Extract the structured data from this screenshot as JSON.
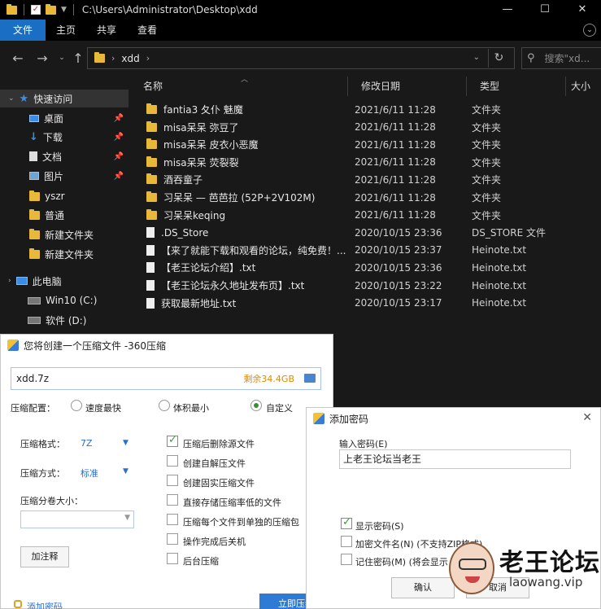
{
  "titlebar": {
    "path": "C:\\Users\\Administrator\\Desktop\\xdd"
  },
  "ribbon": {
    "tabs": [
      "文件",
      "主页",
      "共享",
      "查看"
    ]
  },
  "nav": {
    "crumb": "xdd",
    "search_placeholder": "搜索\"xd..."
  },
  "sidebar": {
    "items": [
      {
        "label": "快速访问",
        "icon": "star-icon",
        "pinned": false
      },
      {
        "label": "桌面",
        "icon": "desktop-icon",
        "pinned": true
      },
      {
        "label": "下载",
        "icon": "download-icon",
        "pinned": true
      },
      {
        "label": "文档",
        "icon": "document-icon",
        "pinned": true
      },
      {
        "label": "图片",
        "icon": "picture-icon",
        "pinned": true
      },
      {
        "label": "yszr",
        "icon": "folder-icon",
        "pinned": false
      },
      {
        "label": "普通",
        "icon": "folder-icon",
        "pinned": false
      },
      {
        "label": "新建文件夹",
        "icon": "folder-icon",
        "pinned": false
      },
      {
        "label": "新建文件夹",
        "icon": "folder-icon",
        "pinned": false
      },
      {
        "label": "此电脑",
        "icon": "computer-icon",
        "pinned": false
      },
      {
        "label": "Win10 (C:)",
        "icon": "drive-icon",
        "pinned": false
      },
      {
        "label": "软件 (D:)",
        "icon": "drive-icon",
        "pinned": false
      }
    ]
  },
  "columns": {
    "name": "名称",
    "date": "修改日期",
    "type": "类型",
    "size": "大小"
  },
  "files": [
    {
      "name": "fantia3 夂仆 魅魔",
      "date": "2021/6/11 11:28",
      "type": "文件夹",
      "kind": "folder"
    },
    {
      "name": "misa呆呆 弥豆了",
      "date": "2021/6/11 11:28",
      "type": "文件夹",
      "kind": "folder"
    },
    {
      "name": "misa呆呆 皮衣小恶魔",
      "date": "2021/6/11 11:28",
      "type": "文件夹",
      "kind": "folder"
    },
    {
      "name": "misa呆呆 荧裂裂",
      "date": "2021/6/11 11:28",
      "type": "文件夹",
      "kind": "folder"
    },
    {
      "name": "酒吞童子",
      "date": "2021/6/11 11:28",
      "type": "文件夹",
      "kind": "folder"
    },
    {
      "name": "习呆呆 — 芭芭拉 (52P+2V102M)",
      "date": "2021/6/11 11:28",
      "type": "文件夹",
      "kind": "folder"
    },
    {
      "name": "习呆呆keqing",
      "date": "2021/6/11 11:28",
      "type": "文件夹",
      "kind": "folder"
    },
    {
      "name": ".DS_Store",
      "date": "2020/10/15 23:36",
      "type": "DS_STORE 文件",
      "kind": "file"
    },
    {
      "name": "【来了就能下载和观看的论坛，纯免费！...",
      "date": "2020/10/15 23:37",
      "type": "Heinote.txt",
      "kind": "file"
    },
    {
      "name": "【老王论坛介绍】.txt",
      "date": "2020/10/15 23:36",
      "type": "Heinote.txt",
      "kind": "file"
    },
    {
      "name": "【老王论坛永久地址发布页】.txt",
      "date": "2020/10/15 23:22",
      "type": "Heinote.txt",
      "kind": "file"
    },
    {
      "name": "获取最新地址.txt",
      "date": "2020/10/15 23:17",
      "type": "Heinote.txt",
      "kind": "file"
    }
  ],
  "zipdlg": {
    "title": "您将创建一个压缩文件 -360压缩",
    "filename": "xdd.7z",
    "remaining": "剩余34.4GB",
    "config_label": "压缩配置：",
    "radios": [
      "速度最快",
      "体积最小",
      "自定义"
    ],
    "format_label": "压缩格式：",
    "format_value": "7Z",
    "method_label": "压缩方式：",
    "method_value": "标准",
    "volume_label": "压缩分卷大小：",
    "comment_button": "加注释",
    "checkboxes": [
      {
        "label": "压缩后删除源文件",
        "checked": true
      },
      {
        "label": "创建自解压文件",
        "checked": false
      },
      {
        "label": "创建固实压缩文件",
        "checked": false
      },
      {
        "label": "直接存储压缩率低的文件",
        "checked": false
      },
      {
        "label": "压缩每个文件到单独的压缩包",
        "checked": false
      },
      {
        "label": "操作完成后关机",
        "checked": false
      },
      {
        "label": "后台压缩",
        "checked": false
      }
    ],
    "add_password_link": "添加密码",
    "start_button": "立即压缩"
  },
  "pwdlg": {
    "title": "添加密码",
    "input_label": "输入密码(E)",
    "password": "上老王论坛当老王",
    "options": [
      {
        "label": "显示密码(S)",
        "checked": true
      },
      {
        "label": "加密文件名(N) (不支持ZIP格式)",
        "checked": false
      },
      {
        "label": "记住密码(M) (将会显示",
        "checked": false
      }
    ],
    "confirm_button": "确认",
    "cancel_button": "取消"
  },
  "watermark": {
    "title": "老王论坛",
    "sub": "laowang.vip"
  }
}
